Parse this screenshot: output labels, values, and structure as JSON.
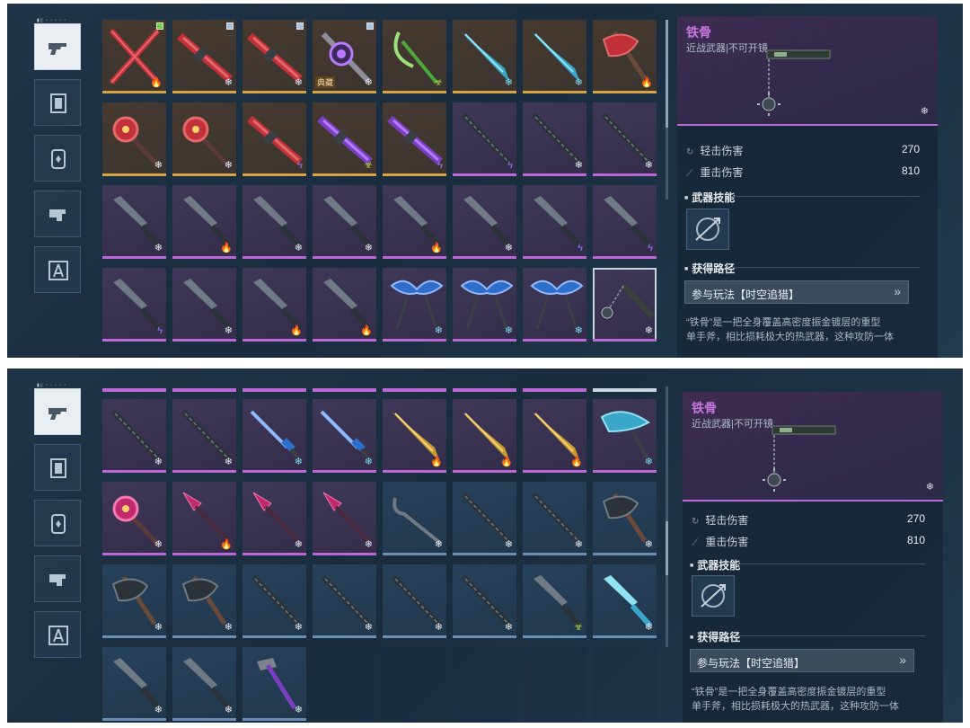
{
  "sidebar": {
    "tag": "▮▯ ▫ ▫ ▫ ▫ ▫",
    "categories": [
      {
        "name": "gun-category",
        "icon": "gun-icon",
        "active": true
      },
      {
        "name": "frame-category",
        "icon": "frame-icon",
        "active": false
      },
      {
        "name": "module-category",
        "icon": "module-icon",
        "active": false
      },
      {
        "name": "component-category",
        "icon": "component-icon",
        "active": false
      },
      {
        "name": "blueprint-category",
        "icon": "compass-icon",
        "active": false
      }
    ]
  },
  "top_grid": {
    "rows": [
      [
        {
          "rarity": "orange",
          "shape": "crossed-red",
          "element": "fire",
          "check": "green"
        },
        {
          "rarity": "orange",
          "shape": "rifle-red",
          "element": "ice",
          "check": "white"
        },
        {
          "rarity": "orange",
          "shape": "rifle-red",
          "element": "ice",
          "check": "white"
        },
        {
          "rarity": "orange",
          "shape": "orb-purple",
          "element": "ice",
          "check": "white",
          "tag": "典藏"
        },
        {
          "rarity": "orange",
          "shape": "scythe-green",
          "element": "poison"
        },
        {
          "rarity": "orange",
          "shape": "blade-cyan",
          "element": "frost"
        },
        {
          "rarity": "orange",
          "shape": "blade-cyan",
          "element": "frost"
        },
        {
          "rarity": "orange",
          "shape": "axe-red",
          "element": "fire"
        }
      ],
      [
        {
          "rarity": "orange",
          "shape": "mace-red",
          "element": "ice"
        },
        {
          "rarity": "orange",
          "shape": "mace-red",
          "element": "ice"
        },
        {
          "rarity": "orange",
          "shape": "rifle-red",
          "element": "shock"
        },
        {
          "rarity": "orange",
          "shape": "rifle-purple",
          "element": "poison"
        },
        {
          "rarity": "orange",
          "shape": "rifle-purple",
          "element": "shock"
        },
        {
          "rarity": "purple",
          "shape": "pole-dark",
          "element": "shock"
        },
        {
          "rarity": "purple",
          "shape": "pole-dark",
          "element": "ice"
        },
        {
          "rarity": "purple",
          "shape": "pole-dark",
          "element": "ice"
        }
      ],
      [
        {
          "rarity": "purple",
          "shape": "knife-dark",
          "element": "ice"
        },
        {
          "rarity": "purple",
          "shape": "knife-dark",
          "element": "fire"
        },
        {
          "rarity": "purple",
          "shape": "knife-dark",
          "element": "ice"
        },
        {
          "rarity": "purple",
          "shape": "knife-dark",
          "element": "ice"
        },
        {
          "rarity": "purple",
          "shape": "knife-dark",
          "element": "fire"
        },
        {
          "rarity": "purple",
          "shape": "knife-dark",
          "element": "ice"
        },
        {
          "rarity": "purple",
          "shape": "knife-dark",
          "element": "shock"
        },
        {
          "rarity": "purple",
          "shape": "knife-dark",
          "element": "shock"
        }
      ],
      [
        {
          "rarity": "purple",
          "shape": "knife-dark",
          "element": "shock"
        },
        {
          "rarity": "purple",
          "shape": "knife-dark",
          "element": "ice"
        },
        {
          "rarity": "purple",
          "shape": "knife-dark",
          "element": "fire"
        },
        {
          "rarity": "purple",
          "shape": "knife-dark",
          "element": "fire"
        },
        {
          "rarity": "purple",
          "shape": "wings-blue",
          "element": "frost"
        },
        {
          "rarity": "purple",
          "shape": "wings-blue",
          "element": "frost"
        },
        {
          "rarity": "purple",
          "shape": "wings-blue",
          "element": "frost"
        },
        {
          "rarity": "purple",
          "shape": "flail",
          "element": "ice",
          "selected": true
        }
      ]
    ]
  },
  "bottom_grid": {
    "rows": [
      [
        {
          "rarity": "purple",
          "shape": "chain-dark",
          "element": "ice"
        },
        {
          "rarity": "purple",
          "shape": "chain-dark",
          "element": "ice"
        },
        {
          "rarity": "purple",
          "shape": "sword-blue",
          "element": "frost"
        },
        {
          "rarity": "purple",
          "shape": "sword-blue",
          "element": "frost"
        },
        {
          "rarity": "purple",
          "shape": "blade-gold",
          "element": "fire"
        },
        {
          "rarity": "purple",
          "shape": "blade-gold",
          "element": "fire"
        },
        {
          "rarity": "purple",
          "shape": "blade-gold",
          "element": "fire"
        },
        {
          "rarity": "purple",
          "shape": "curved-cyan",
          "element": "frost"
        }
      ],
      [
        {
          "rarity": "purple",
          "shape": "mace-pink",
          "element": "ice"
        },
        {
          "rarity": "purple",
          "shape": "spear-pink",
          "element": "fire"
        },
        {
          "rarity": "purple",
          "shape": "spear-pink",
          "element": "ice"
        },
        {
          "rarity": "purple",
          "shape": "spear-pink",
          "element": "ice"
        },
        {
          "rarity": "blue",
          "shape": "hook-dark",
          "element": "ice"
        },
        {
          "rarity": "blue",
          "shape": "pole-dark",
          "element": "ice"
        },
        {
          "rarity": "blue",
          "shape": "pole-dark",
          "element": "ice"
        },
        {
          "rarity": "blue",
          "shape": "axe-dark",
          "element": "ice"
        }
      ],
      [
        {
          "rarity": "blue",
          "shape": "axe-dark",
          "element": "ice"
        },
        {
          "rarity": "blue",
          "shape": "axe-dark",
          "element": "ice"
        },
        {
          "rarity": "blue",
          "shape": "baton-dark",
          "element": "ice"
        },
        {
          "rarity": "blue",
          "shape": "baton-dark",
          "element": "ice"
        },
        {
          "rarity": "blue",
          "shape": "pole-dark",
          "element": "ice"
        },
        {
          "rarity": "blue",
          "shape": "pole-dark",
          "element": "ice"
        },
        {
          "rarity": "blue",
          "shape": "dagger-dark",
          "element": "poison"
        },
        {
          "rarity": "blue",
          "shape": "knife-cyan",
          "element": "ice"
        }
      ],
      [
        {
          "rarity": "blue",
          "shape": "dagger-dark",
          "element": "ice"
        },
        {
          "rarity": "blue",
          "shape": "dagger-dark",
          "element": "ice"
        },
        {
          "rarity": "blue",
          "shape": "hammer-purple",
          "element": "ice"
        }
      ]
    ]
  },
  "element_icons": {
    "fire": "🔥",
    "ice": "❄",
    "frost": "❄",
    "shock": "ϟ",
    "poison": "☣"
  },
  "colors": {
    "orange_bar": "#d6a443",
    "purple_bar": "#b968d6",
    "blue_bar": "#6a8fb0",
    "name": "#c877e0"
  },
  "detail": {
    "name": "铁骨",
    "type": "近战武器|不可开镜",
    "light_label": "轻击伤害",
    "light_value": "270",
    "heavy_label": "重击伤害",
    "heavy_value": "810",
    "skill_section": "武器技能",
    "route_section": "获得路径",
    "route_button": "参与玩法【时空追猎】",
    "description_line1": "“铁骨”是一把全身覆盖高密度振金镀层的重型",
    "description_line2": "单手斧，相比损耗极大的热武器，这种攻防一体"
  }
}
